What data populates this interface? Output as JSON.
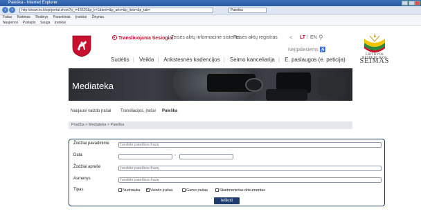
{
  "browser": {
    "title": "Paieška - Internet Explorer",
    "url": "http://www.lrs.lt/sip/portal.show?p_r=15526&p_k=1&text=&p_arts=&p_lists=&p_tab=",
    "tab_label": "Paieška",
    "menu": [
      "Failas",
      "Keitimas",
      "Rodinys",
      "Parankiniai",
      "Įrankiai",
      "Žinynas"
    ],
    "favorites": [
      "Naujienos",
      "Puslapis",
      "Sauga",
      "Įrankiai"
    ]
  },
  "header": {
    "live_label": "Transliuojama tiesiogiai",
    "info_system_link": "Teisės aktų informacinė sistema",
    "register_link": "Teisės aktų registras",
    "lang_lt": "LT",
    "lang_sep": "/",
    "lang_en": "EN",
    "accessibility_label": "Neįgaliesiems",
    "logo_line1": "LIETUVOS RESPUBLIKOS",
    "logo_line2": "SEIMAS"
  },
  "main_nav": {
    "items": [
      "Sudėtis",
      "Veikla",
      "Ankstesnės kadencijos",
      "Seimo kanceliarija",
      "E. paslaugos (e. peticija)"
    ]
  },
  "banner": {
    "title": "Mediateka"
  },
  "sub_nav": {
    "items": [
      "Naujausi vaizdo įrašai",
      "Transliacijos, įrašai",
      "Paieška"
    ]
  },
  "breadcrumb": {
    "text": "Pradžia > Mediateka > Paieška"
  },
  "form": {
    "title_words_label": "Žodžiai pavadinime",
    "title_words_placeholder": "Įveskite paieškos frazę",
    "date_label": "Data",
    "date_sep": "-",
    "desc_words_label": "Žodžiai apraše",
    "desc_words_placeholder": "Įveskite paieškos frazę",
    "persons_label": "Asmenys",
    "persons_placeholder": "Įveskite paieškos frazę",
    "types_label": "Tipas",
    "types": [
      {
        "label": "Nuotrauka",
        "checked": false
      },
      {
        "label": "Vaizdo įrašas",
        "checked": true
      },
      {
        "label": "Garso įrašas",
        "checked": false
      },
      {
        "label": "Skaitmenintas dokumentas",
        "checked": false
      }
    ],
    "search_button": "Ieškoti"
  },
  "colors": {
    "accent_red": "#c8102e",
    "navy": "#1e3b6d"
  }
}
